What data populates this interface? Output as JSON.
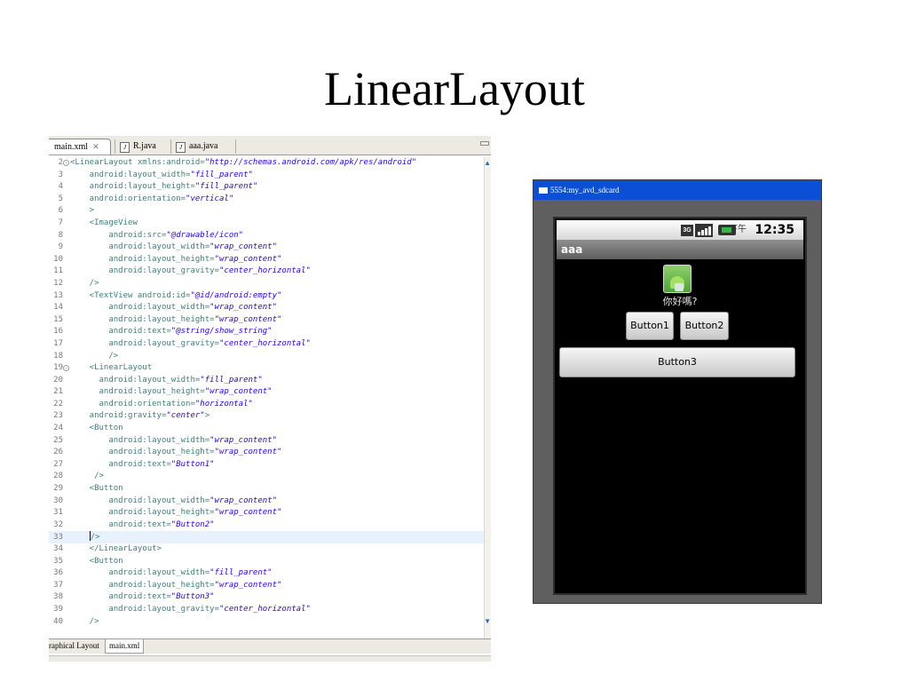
{
  "slide": {
    "title": "LinearLayout"
  },
  "editor": {
    "tabs": [
      {
        "label": "main.xml",
        "close": "✕"
      },
      {
        "label": "R.java",
        "icon": "J"
      },
      {
        "label": "aaa.java",
        "icon": "J"
      }
    ],
    "lines": [
      {
        "n": "2",
        "fold": "-",
        "html": "<LinearLayout xmlns:android=\"http://schemas.android.com/apk/res/android\""
      },
      {
        "n": "3",
        "text": "    android:layout_width=\"fill_parent\""
      },
      {
        "n": "4",
        "text": "    android:layout_height=\"fill_parent\""
      },
      {
        "n": "5",
        "text": "    android:orientation=\"vertical\""
      },
      {
        "n": "6",
        "text": "    >"
      },
      {
        "n": "7",
        "text": "    <ImageView"
      },
      {
        "n": "8",
        "text": "        android:src=\"@drawable/icon\""
      },
      {
        "n": "9",
        "text": "        android:layout_width=\"wrap_content\""
      },
      {
        "n": "10",
        "text": "        android:layout_height=\"wrap_content\""
      },
      {
        "n": "11",
        "text": "        android:layout_gravity=\"center_horizontal\""
      },
      {
        "n": "12",
        "text": "    />"
      },
      {
        "n": "13",
        "text": "    <TextView android:id=\"@id/android:empty\""
      },
      {
        "n": "14",
        "text": "        android:layout_width=\"wrap_content\""
      },
      {
        "n": "15",
        "text": "        android:layout_height=\"wrap_content\""
      },
      {
        "n": "16",
        "text": "        android:text=\"@string/show_string\""
      },
      {
        "n": "17",
        "text": "        android:layout_gravity=\"center_horizontal\""
      },
      {
        "n": "18",
        "text": "        />"
      },
      {
        "n": "19",
        "fold": "-",
        "text": "    <LinearLayout"
      },
      {
        "n": "20",
        "text": "      android:layout_width=\"fill_parent\""
      },
      {
        "n": "21",
        "text": "      android:layout_height=\"wrap_content\""
      },
      {
        "n": "22",
        "text": "      android:orientation=\"horizontal\""
      },
      {
        "n": "23",
        "text": "    android:gravity=\"center\">"
      },
      {
        "n": "24",
        "text": "    <Button"
      },
      {
        "n": "25",
        "text": "        android:layout_width=\"wrap_content\""
      },
      {
        "n": "26",
        "text": "        android:layout_height=\"wrap_content\""
      },
      {
        "n": "27",
        "text": "        android:text=\"Button1\""
      },
      {
        "n": "28",
        "text": "     />"
      },
      {
        "n": "29",
        "text": "    <Button"
      },
      {
        "n": "30",
        "text": "        android:layout_width=\"wrap_content\""
      },
      {
        "n": "31",
        "text": "        android:layout_height=\"wrap_content\""
      },
      {
        "n": "32",
        "text": "        android:text=\"Button2\""
      },
      {
        "n": "33",
        "text": "    />",
        "current": true
      },
      {
        "n": "34",
        "text": "    </LinearLayout>"
      },
      {
        "n": "35",
        "text": "    <Button"
      },
      {
        "n": "36",
        "text": "        android:layout_width=\"fill_parent\""
      },
      {
        "n": "37",
        "text": "        android:layout_height=\"wrap_content\""
      },
      {
        "n": "38",
        "text": "        android:text=\"Button3\""
      },
      {
        "n": "39",
        "text": "        android:layout_gravity=\"center_horizontal\""
      },
      {
        "n": "40",
        "text": "    />"
      }
    ],
    "bottom_tabs": {
      "graphical": "raphical Layout",
      "xml": "main.xml"
    }
  },
  "emulator": {
    "title": "5554:my_avd_sdcard",
    "status": {
      "network": "3G",
      "ampm": "下午",
      "time": "12:35"
    },
    "app_title": "aaa",
    "text": "你好嗎?",
    "buttons": {
      "b1": "Button1",
      "b2": "Button2",
      "b3": "Button3"
    }
  }
}
